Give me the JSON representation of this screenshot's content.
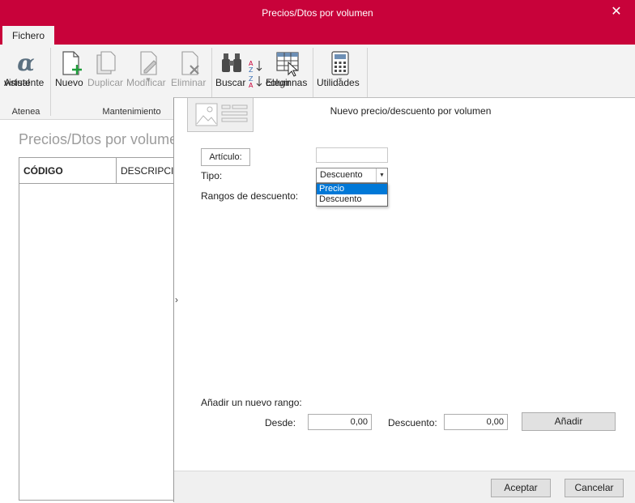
{
  "window": {
    "title": "Precios/Dtos por volumen",
    "close_glyph": "✕"
  },
  "ribbon": {
    "tab": "Fichero",
    "groups": {
      "atenea": "Atenea",
      "mantenimiento": "Mantenimiento"
    },
    "buttons": {
      "asistente_line1": "Asistente",
      "asistente_line2": "virtual",
      "nuevo": "Nuevo",
      "duplicar": "Duplicar",
      "modificar": "Modificar",
      "eliminar": "Eliminar",
      "buscar": "Buscar",
      "elegir_line1": "Elegir",
      "elegir_line2": "columnas",
      "utilidades": "Utilidades"
    },
    "icons": {
      "asistente": "alpha-icon",
      "nuevo": "new-document-icon",
      "duplicar": "duplicate-icon",
      "modificar": "edit-document-icon",
      "eliminar": "delete-document-icon",
      "buscar": "binoculars-icon",
      "sort": "sort-az-icon",
      "elegir": "choose-columns-icon",
      "utilidades": "calculator-icon"
    },
    "accent": "#c8023a"
  },
  "list_panel": {
    "title": "Precios/Dtos por volumen",
    "columns": [
      "CÓDIGO",
      "DESCRIPCIÓN"
    ]
  },
  "dialog": {
    "title": "Nuevo precio/descuento por volumen",
    "image_icon": "image-placeholder-icon",
    "expander_glyph": "›",
    "articulo_button": "Artículo:",
    "articulo_value": "",
    "tipo_label": "Tipo:",
    "tipo_selected": "Descuento",
    "tipo_options": [
      "Precio",
      "Descuento"
    ],
    "tipo_highlighted": "Precio",
    "rangos_label": "Rangos de descuento:",
    "add_range_label": "Añadir un nuevo rango:",
    "desde_label": "Desde:",
    "desde_value": "0,00",
    "descuento_label": "Descuento:",
    "descuento_value": "0,00",
    "add_button": "Añadir",
    "accept_button": "Aceptar",
    "cancel_button": "Cancelar",
    "selection_color": "#0078d7"
  }
}
